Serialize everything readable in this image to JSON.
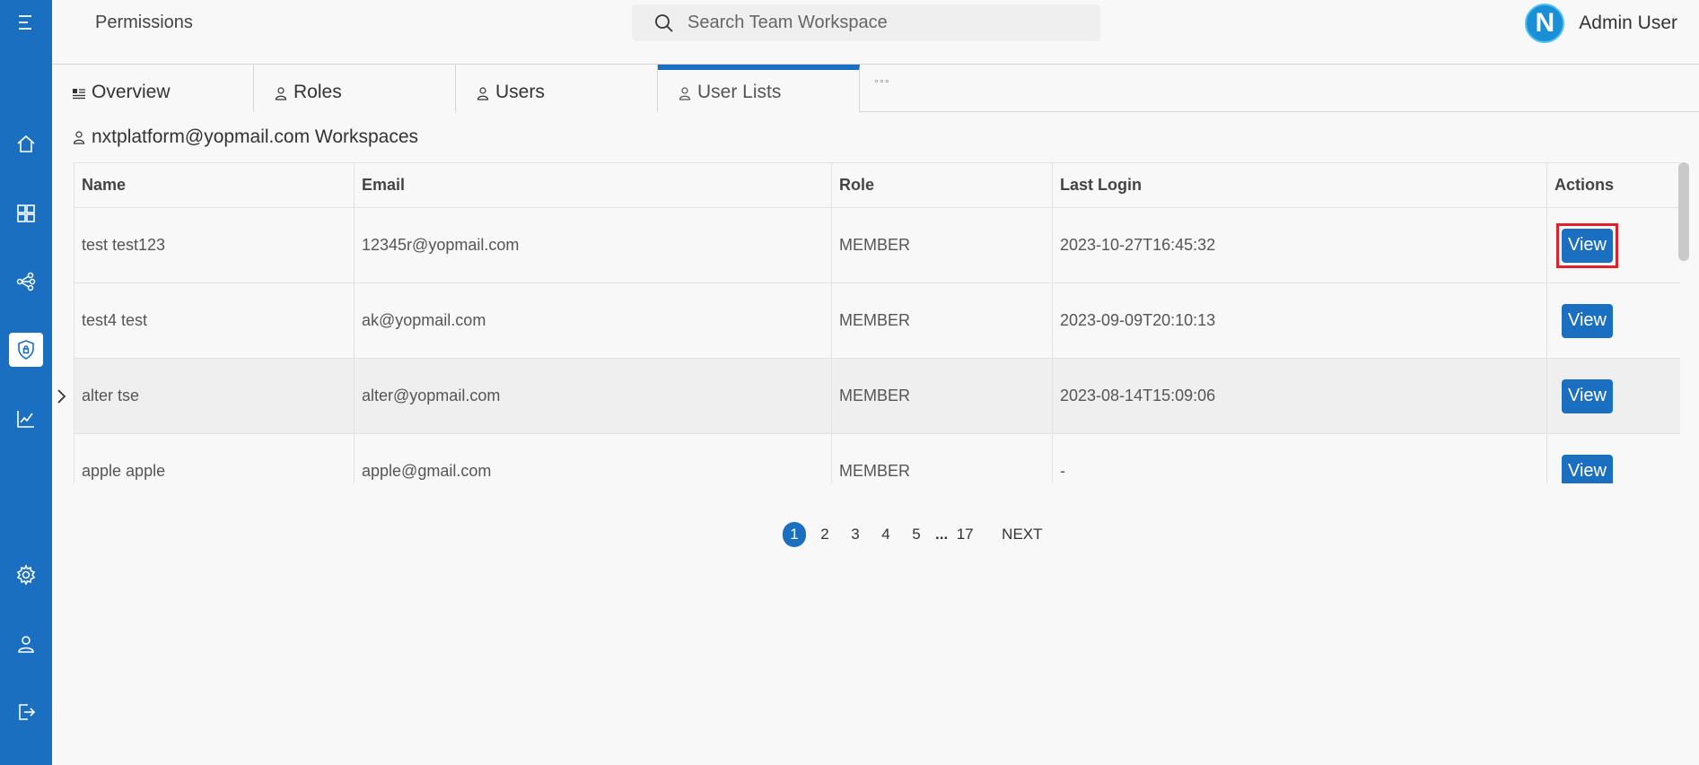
{
  "header": {
    "title": "Permissions",
    "search_placeholder": "Search Team Workspace",
    "avatar_letter": "N",
    "user_name": "Admin User"
  },
  "tabs": [
    {
      "label": "Overview",
      "icon": "newspaper-icon"
    },
    {
      "label": "Roles",
      "icon": "user-icon"
    },
    {
      "label": "Users",
      "icon": "user-icon"
    },
    {
      "label": "User Lists",
      "icon": "user-icon",
      "active": true
    }
  ],
  "tab_more": "°°°",
  "section_title": "nxtplatform@yopmail.com Workspaces",
  "table": {
    "columns": [
      "Name",
      "Email",
      "Role",
      "Last Login",
      "Actions"
    ],
    "rows": [
      {
        "name": "test test123",
        "email": "12345r@yopmail.com",
        "role": "MEMBER",
        "last_login": "2023-10-27T16:45:32",
        "action": "View"
      },
      {
        "name": "test4 test",
        "email": "ak@yopmail.com",
        "role": "MEMBER",
        "last_login": "2023-09-09T20:10:13",
        "action": "View"
      },
      {
        "name": "alter tse",
        "email": "alter@yopmail.com",
        "role": "MEMBER",
        "last_login": "2023-08-14T15:09:06",
        "action": "View"
      },
      {
        "name": "apple apple",
        "email": "apple@gmail.com",
        "role": "MEMBER",
        "last_login": "-",
        "action": "View"
      }
    ]
  },
  "pagination": {
    "pages": [
      "1",
      "2",
      "3",
      "4",
      "5"
    ],
    "ellipsis": "...",
    "last": "17",
    "next": "NEXT",
    "current": "1"
  },
  "colors": {
    "sidebar": "#1a6fc0",
    "accent": "#1a6fc0",
    "focus_outline": "#e0202a"
  }
}
